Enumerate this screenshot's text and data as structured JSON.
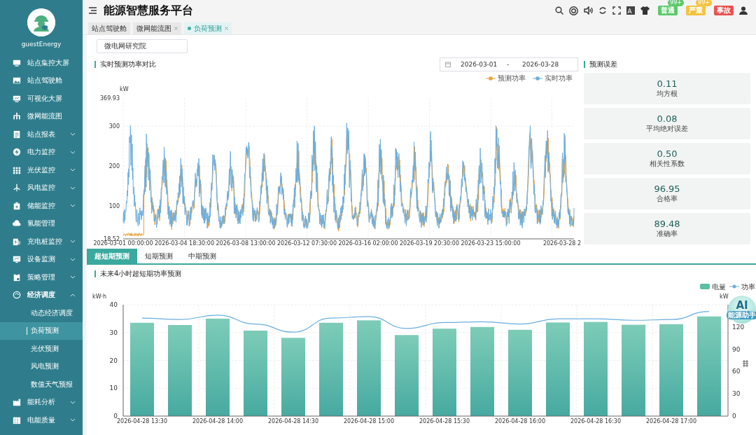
{
  "sidebar": {
    "user": "guestEnergy",
    "items": [
      {
        "label": "站点集控大屏",
        "kind": "link",
        "selected": false
      },
      {
        "label": "站点驾驶舱",
        "kind": "link",
        "selected": false
      },
      {
        "label": "可视化大屏",
        "kind": "link",
        "selected": false
      },
      {
        "label": "微网能流图",
        "kind": "link",
        "selected": false
      },
      {
        "label": "站点报表",
        "kind": "group",
        "expanded": false,
        "selected": false
      },
      {
        "label": "电力监控",
        "kind": "group",
        "expanded": false,
        "selected": false
      },
      {
        "label": "光伏监控",
        "kind": "group",
        "expanded": false,
        "selected": false
      },
      {
        "label": "风电监控",
        "kind": "group",
        "expanded": false,
        "selected": false
      },
      {
        "label": "储能监控",
        "kind": "group",
        "expanded": false,
        "selected": false
      },
      {
        "label": "氢能管理",
        "kind": "link",
        "selected": false
      },
      {
        "label": "充电桩监控",
        "kind": "group",
        "expanded": false,
        "selected": false
      },
      {
        "label": "设备监测",
        "kind": "group",
        "expanded": false,
        "selected": false
      },
      {
        "label": "策略管理",
        "kind": "group",
        "expanded": false,
        "selected": false
      },
      {
        "label": "经济调度",
        "kind": "group",
        "expanded": true,
        "selected": false,
        "children": [
          {
            "label": "动态经济调度",
            "selected": false
          },
          {
            "label": "负荷预测",
            "selected": true
          },
          {
            "label": "光伏预测",
            "selected": false
          },
          {
            "label": "风电预测",
            "selected": false
          },
          {
            "label": "数值天气预报",
            "selected": false
          }
        ]
      },
      {
        "label": "能耗分析",
        "kind": "group",
        "expanded": false,
        "selected": false
      },
      {
        "label": "电能质量",
        "kind": "group",
        "expanded": false,
        "selected": false
      }
    ]
  },
  "header": {
    "title": "能源智慧服务平台",
    "badges": [
      {
        "label": "普通",
        "count": "99+",
        "color": "#5cc96b"
      },
      {
        "label": "严重",
        "count": "99+",
        "color": "#f5c342"
      },
      {
        "label": "事故",
        "color": "#e9534f"
      }
    ]
  },
  "tabs": [
    {
      "label": "站点驾驶舱",
      "closable": false,
      "selected": false
    },
    {
      "label": "微网能流图",
      "closable": true,
      "selected": false
    },
    {
      "label": "负荷预测",
      "closable": true,
      "selected": true
    }
  ],
  "station_select": {
    "value": "微电网研究院"
  },
  "realtime": {
    "title": "实时预测功率对比",
    "date_start": "2026-03-01",
    "date_sep": "-",
    "date_end": "2026-03-28",
    "legend": [
      {
        "name": "预测功率",
        "color": "#e8a33d"
      },
      {
        "name": "实时功率",
        "color": "#6aaee0"
      }
    ],
    "unit": "kW",
    "y_labels": [
      "369.93",
      "300",
      "200",
      "100",
      "18.52"
    ],
    "x_labels": [
      "2026-03-01 00:00:00",
      "2026-03-04 18:30:00",
      "2026-03-08 13:00:00",
      "2026-03-12 07:30:00",
      "2026-03-16 02:00:00",
      "2026-03-19 20:30:00",
      "2026-03-23 15:00:00",
      "2026-03-28 2"
    ]
  },
  "errors": {
    "title": "预测误差",
    "metrics": [
      {
        "value": "0.11",
        "label": "均方根"
      },
      {
        "value": "0.08",
        "label": "平均绝对误差"
      },
      {
        "value": "0.50",
        "label": "相关性系数"
      },
      {
        "value": "96.95",
        "label": "合格率"
      },
      {
        "value": "89.48",
        "label": "准确率"
      }
    ]
  },
  "forecast_tabs": [
    {
      "label": "超短期预测",
      "selected": true
    },
    {
      "label": "短期预测",
      "selected": false
    },
    {
      "label": "中期预测",
      "selected": false
    }
  ],
  "forecast": {
    "title": "未来4小时超短期功率预测",
    "chart_data": {
      "type": "bar",
      "grid": true,
      "ylabel": "kW·h",
      "ylim": [
        0,
        40
      ],
      "yticks": [
        0,
        10,
        20,
        30,
        40
      ],
      "categories": [
        "2026-04-28 13:30",
        null,
        "2026-04-28 14:00",
        null,
        "2026-04-28 14:30",
        null,
        "2026-04-28 15:00",
        null,
        "2026-04-28 15:30",
        null,
        "2026-04-28 16:00",
        null,
        "2026-04-28 16:30",
        null,
        "2026-04-28 17:00",
        null
      ],
      "series": [
        {
          "name": "电量",
          "color": "#5cbfa6",
          "values": [
            33.5,
            32.7,
            35,
            30.7,
            28.1,
            33.5,
            34.4,
            29.1,
            31.4,
            32,
            31,
            33.6,
            33.8,
            32.8,
            33,
            35.8
          ]
        }
      ]
    },
    "power": {
      "chart_data": {
        "type": "line",
        "ylabel": "kW",
        "ylim": [
          0,
          150
        ],
        "yticks": [
          0,
          30,
          60,
          90,
          120
        ],
        "series": [
          {
            "name": "功率",
            "color": "#6aaee0",
            "values": [
              132,
              130,
              136,
              124,
              113,
              132,
              134,
              118,
              126,
              127,
              124,
              131,
              131,
              129,
              130,
              141
            ]
          }
        ]
      }
    }
  },
  "ai_assistant": {
    "label": "AI",
    "caption": "能源助手"
  }
}
